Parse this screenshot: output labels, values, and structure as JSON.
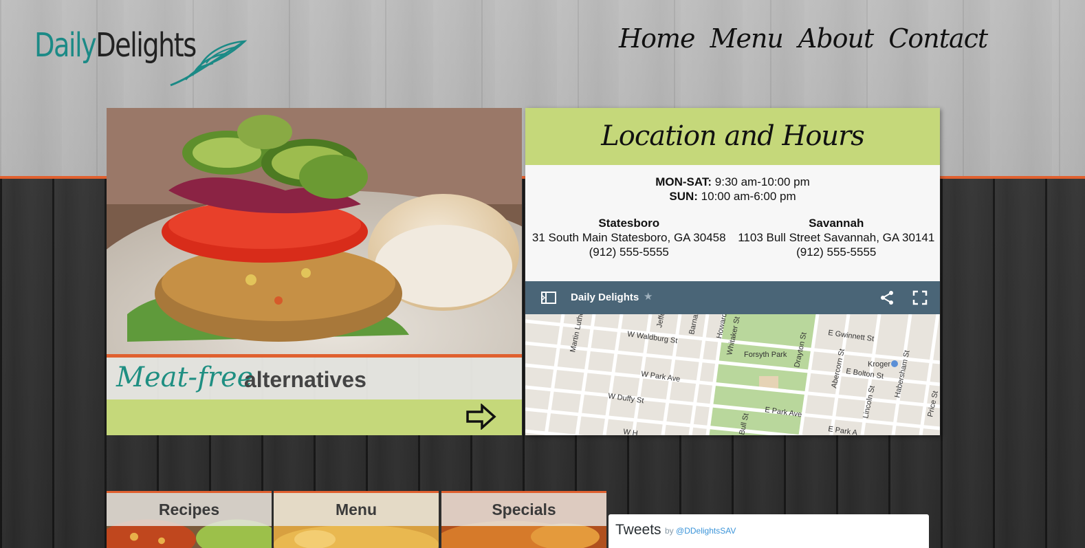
{
  "brand": {
    "logo_part1": "Daily",
    "logo_part2": "Delights",
    "accent": "#1b8a86",
    "orange": "#e0602f",
    "green": "#c5d87a"
  },
  "nav": [
    "Home",
    "Menu",
    "About",
    "Contact"
  ],
  "feature": {
    "script_text": "Meat-free",
    "bold_text": "alternatives",
    "arrow_icon": "right-arrow-icon"
  },
  "location": {
    "title": "Location and Hours",
    "hours": [
      {
        "days": "MON-SAT:",
        "time": "9:30 am-10:00 pm"
      },
      {
        "days": "SUN:",
        "time": "10:00 am-6:00 pm"
      }
    ],
    "stores": [
      {
        "name": "Statesboro",
        "address": "31 South Main Statesboro, GA 30458",
        "phone": "(912) 555-5555"
      },
      {
        "name": "Savannah",
        "address": "1103 Bull Street Savannah, GA 30141",
        "phone": "(912) 555-5555"
      }
    ]
  },
  "map": {
    "title": "Daily Delights",
    "icons": [
      "sidebar-toggle-icon",
      "star-icon",
      "share-icon",
      "fullscreen-icon"
    ],
    "labels": [
      "Martin Luther K",
      "Jeffe",
      "Barnar",
      "Howard",
      "Whitaker St",
      "W Waldburg St",
      "Forsyth Park",
      "Drayton St",
      "E Gwinnett St",
      "Kroger",
      "Abercorn St",
      "E Bolton St",
      "Habersham St",
      "W Park Ave",
      "Lincoln St",
      "Price St",
      "W Duffy St",
      "Bull St",
      "E Park Ave",
      "E Park A",
      "W H"
    ]
  },
  "tiles": [
    "Recipes",
    "Menu",
    "Specials"
  ],
  "tweets": {
    "title": "Tweets",
    "by": "by",
    "handle": "@DDelightsSAV"
  }
}
